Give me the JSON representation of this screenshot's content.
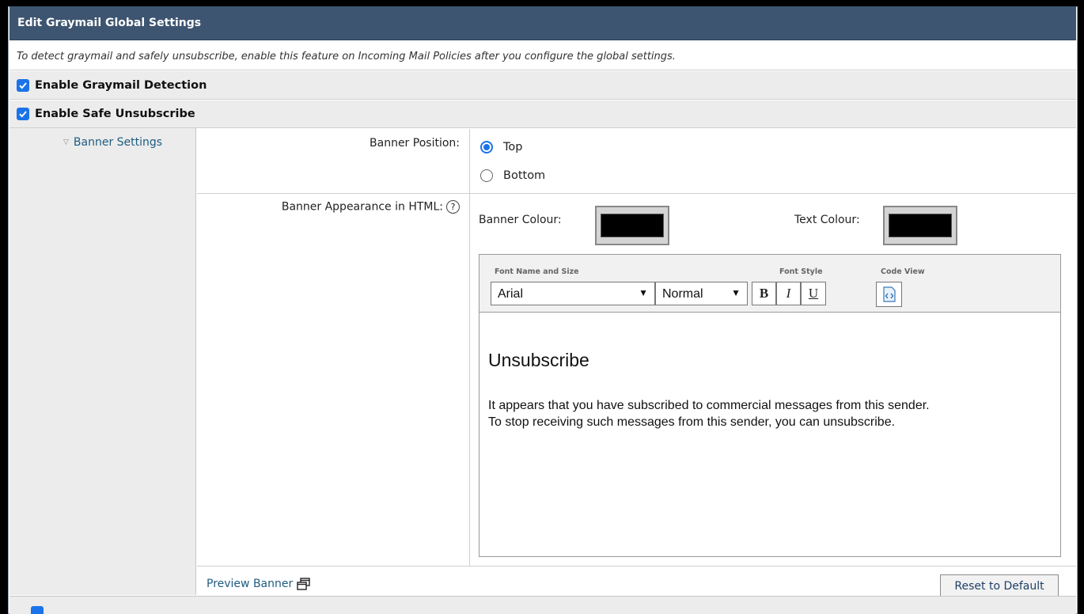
{
  "panel": {
    "title": "Edit Graymail Global Settings",
    "description": "To detect graymail and safely unsubscribe, enable this feature on Incoming Mail Policies after you configure the global settings."
  },
  "options": {
    "graymail_detection": {
      "label": "Enable Graymail Detection",
      "checked": true
    },
    "safe_unsubscribe": {
      "label": "Enable Safe Unsubscribe",
      "checked": true
    }
  },
  "banner_settings": {
    "section_label": "Banner Settings",
    "position_label": "Banner Position:",
    "position_options": [
      {
        "label": "Top",
        "selected": true
      },
      {
        "label": "Bottom",
        "selected": false
      }
    ],
    "appearance_label": "Banner Appearance in HTML:",
    "help_glyph": "?",
    "banner_colour_label": "Banner Colour:",
    "banner_colour": "#000000",
    "text_colour_label": "Text Colour:",
    "text_colour": "#000000"
  },
  "editor": {
    "font_name_size_label": "Font Name and Size",
    "font_style_label": "Font Style",
    "code_view_label": "Code View",
    "font_name": "Arial",
    "font_size": "Normal",
    "bold_glyph": "B",
    "italic_glyph": "I",
    "underline_glyph": "U",
    "heading": "Unsubscribe",
    "body_line1": "It appears that you have subscribed to commercial messages from this sender.",
    "body_line2": "To stop receiving such messages from this sender, you can unsubscribe."
  },
  "footer": {
    "preview_label": "Preview Banner",
    "reset_label": "Reset to Default"
  },
  "colors": {
    "header_bg": "#3d5570",
    "checkbox": "#1a73e8",
    "link": "#1f5c80"
  }
}
